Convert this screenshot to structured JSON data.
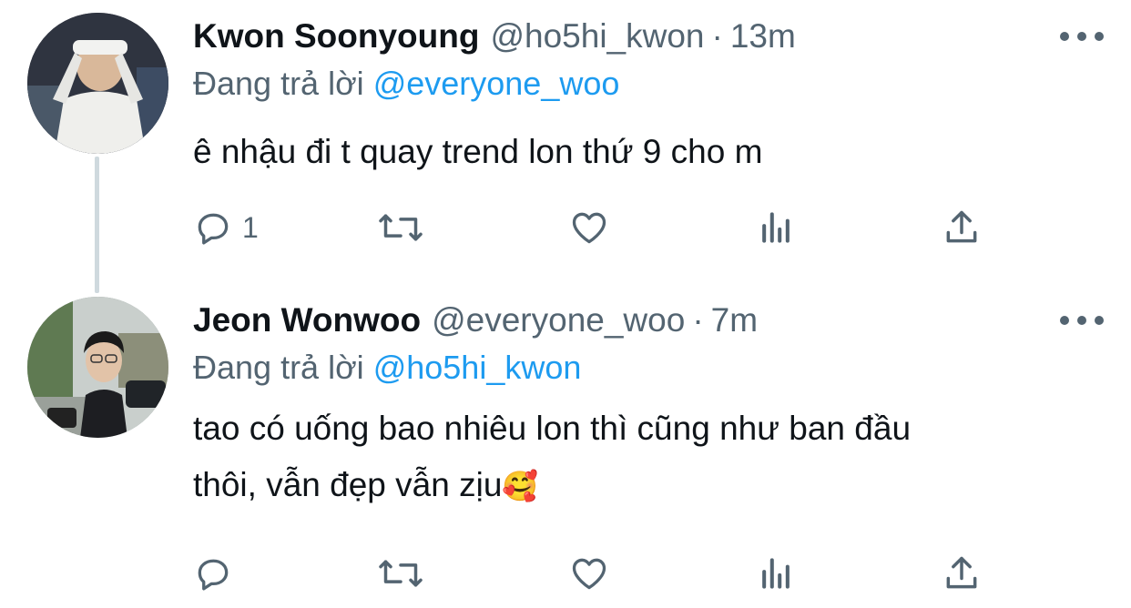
{
  "tweets": [
    {
      "display_name": "Kwon Soonyoung",
      "handle": "@ho5hi_kwon",
      "separator": "·",
      "time": "13m",
      "replying_label": "Đang trả lời",
      "replying_to": "@everyone_woo",
      "text": "ê nhậu đi t quay trend lon thứ 9 cho m",
      "reply_count": "1",
      "avatar": "avatar-photo"
    },
    {
      "display_name": "Jeon Wonwoo",
      "handle": "@everyone_woo",
      "separator": "·",
      "time": "7m",
      "replying_label": "Đang trả lời",
      "replying_to": "@ho5hi_kwon",
      "text_line1": "tao có uống bao nhiêu lon thì cũng như ban đầu",
      "text_line2": "thôi, vẫn đẹp vẫn zịu",
      "emoji": "🥰",
      "reply_count": "",
      "avatar": "avatar-photo"
    }
  ],
  "icons": {
    "reply": "reply-icon",
    "retweet": "retweet-icon",
    "like": "heart-icon",
    "views": "views-icon",
    "share": "share-icon",
    "more": "more-icon"
  },
  "colors": {
    "text": "#0f1419",
    "secondary": "#536471",
    "link": "#1d9bf0",
    "thread_line": "#cfd9de"
  }
}
